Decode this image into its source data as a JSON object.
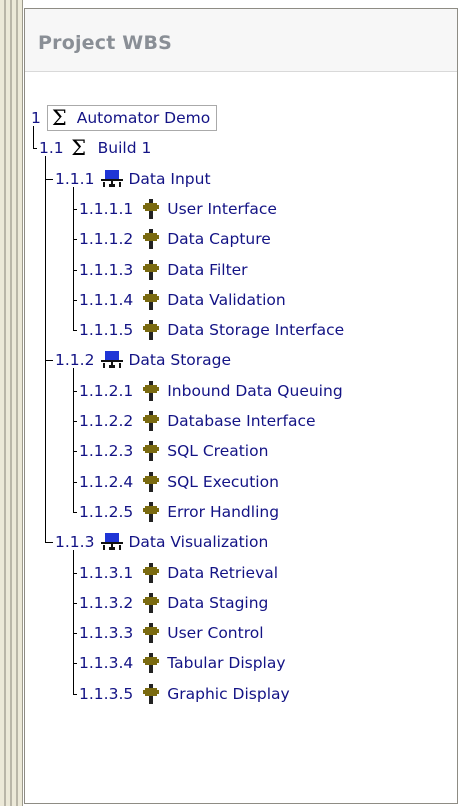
{
  "panel": {
    "title": "Project WBS"
  },
  "icons": {
    "summary": "sigma-icon",
    "workpackage": "network-icon",
    "task": "task-icon"
  },
  "colors": {
    "node_text": "#131385",
    "network_icon": "#1f35d6",
    "task_icon": "#7a6a10"
  },
  "tree": {
    "root": {
      "num": "1",
      "label": "Automator Demo"
    },
    "build": {
      "num": "1.1",
      "label": "Build 1"
    },
    "groups": [
      {
        "num": "1.1.1",
        "label": "Data Input",
        "tasks": [
          {
            "num": "1.1.1.1",
            "label": "User Interface"
          },
          {
            "num": "1.1.1.2",
            "label": "Data Capture"
          },
          {
            "num": "1.1.1.3",
            "label": "Data Filter"
          },
          {
            "num": "1.1.1.4",
            "label": "Data Validation"
          },
          {
            "num": "1.1.1.5",
            "label": "Data Storage Interface"
          }
        ]
      },
      {
        "num": "1.1.2",
        "label": "Data Storage",
        "tasks": [
          {
            "num": "1.1.2.1",
            "label": "Inbound Data Queuing"
          },
          {
            "num": "1.1.2.2",
            "label": "Database Interface"
          },
          {
            "num": "1.1.2.3",
            "label": "SQL Creation"
          },
          {
            "num": "1.1.2.4",
            "label": "SQL Execution"
          },
          {
            "num": "1.1.2.5",
            "label": "Error Handling"
          }
        ]
      },
      {
        "num": "1.1.3",
        "label": "Data Visualization",
        "tasks": [
          {
            "num": "1.1.3.1",
            "label": "Data Retrieval"
          },
          {
            "num": "1.1.3.2",
            "label": "Data Staging"
          },
          {
            "num": "1.1.3.3",
            "label": "User Control"
          },
          {
            "num": "1.1.3.4",
            "label": "Tabular Display"
          },
          {
            "num": "1.1.3.5",
            "label": "Graphic Display"
          }
        ]
      }
    ]
  }
}
